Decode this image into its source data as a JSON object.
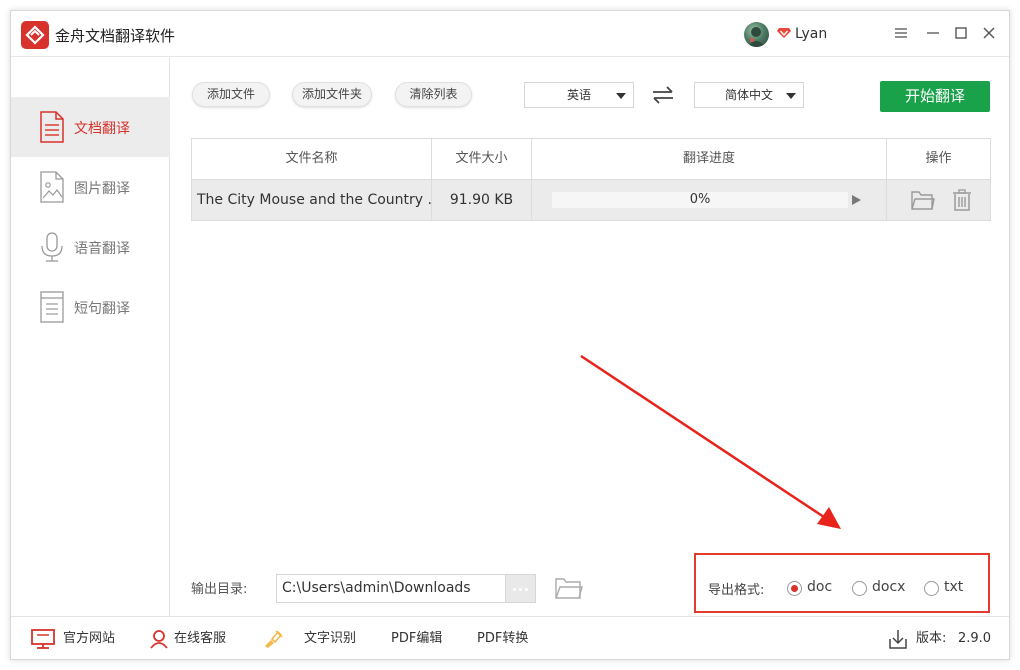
{
  "app": {
    "title": "金舟文档翻译软件"
  },
  "user": {
    "name": "Lyan"
  },
  "colors": {
    "brand": "#d8322c",
    "accent_green": "#1aa24a",
    "highlight_red": "#e23a2e"
  },
  "sidebar": {
    "items": [
      {
        "label": "文档翻译",
        "icon": "document-icon",
        "active": true
      },
      {
        "label": "图片翻译",
        "icon": "image-icon",
        "active": false
      },
      {
        "label": "语音翻译",
        "icon": "microphone-icon",
        "active": false
      },
      {
        "label": "短句翻译",
        "icon": "sentence-icon",
        "active": false
      }
    ]
  },
  "toolbar": {
    "add_file": "添加文件",
    "add_folder": "添加文件夹",
    "clear_list": "清除列表",
    "source_lang": "英语",
    "target_lang": "简体中文",
    "start": "开始翻译"
  },
  "table": {
    "headers": {
      "name": "文件名称",
      "size": "文件大小",
      "progress": "翻译进度",
      "ops": "操作"
    },
    "rows": [
      {
        "name": "The City Mouse and the Country ...",
        "size": "91.90 KB",
        "progress_text": "0%",
        "progress": 0
      }
    ]
  },
  "output": {
    "label": "输出目录:",
    "path": "C:\\Users\\admin\\Downloads"
  },
  "export": {
    "label": "导出格式:",
    "options": [
      {
        "label": "doc",
        "checked": true
      },
      {
        "label": "docx",
        "checked": false
      },
      {
        "label": "txt",
        "checked": false
      }
    ]
  },
  "footer": {
    "website": "官方网站",
    "service": "在线客服",
    "ocr": "文字识别",
    "pdf_edit": "PDF编辑",
    "pdf_convert": "PDF转换",
    "version_label": "版本:",
    "version": "2.9.0"
  }
}
